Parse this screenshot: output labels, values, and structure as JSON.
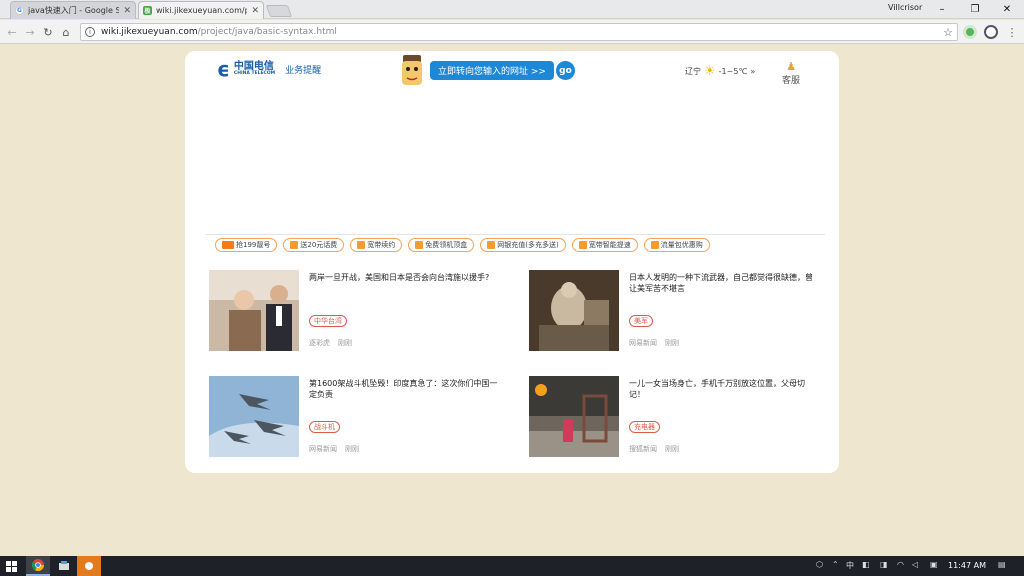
{
  "browser": {
    "tabs": [
      {
        "title": "java快速入门 - Google S",
        "favicon": "G"
      },
      {
        "title": "wiki.jikexueyuan.com/pro",
        "favicon": "极"
      }
    ],
    "user": "Villcrisor",
    "url_host": "wiki.jikexueyuan.com",
    "url_path": "/project/java/basic-syntax.html"
  },
  "header": {
    "logo_cn": "中国电信",
    "logo_en": "CHINA TELECOM",
    "service_label": "业务提醒",
    "redirect_label": "立即转向您输入的网址 >>",
    "go_label": "go",
    "weather_city": "辽宁",
    "weather_temp": "-1~5℃",
    "weather_more": "»",
    "kefu_label": "客服"
  },
  "promo_pills": [
    {
      "icon_text": "199",
      "label": "抢199靓号"
    },
    {
      "icon_text": "",
      "label": "送20元话费"
    },
    {
      "icon_text": "",
      "label": "宽带续约"
    },
    {
      "icon_text": "",
      "label": "免费领机顶盒"
    },
    {
      "icon_text": "",
      "label": "网银充值(多充多送)"
    },
    {
      "icon_text": "",
      "label": "宽带智能提速"
    },
    {
      "icon_text": "",
      "label": "流量包优惠购"
    }
  ],
  "news": [
    {
      "title": "两岸一旦开战，美国和日本是否会向台湾施以援手?",
      "tag": "中华台湾",
      "source": "逐彩虎",
      "time": "刚刚"
    },
    {
      "title": "日本人发明的一种下流武器，自己都觉得很缺德，曾让美军苦不堪言",
      "tag": "美军",
      "source": "网易新闻",
      "time": "刚刚"
    },
    {
      "title": "第1600架战斗机坠毁！印度真急了：这次你们中国一定负责",
      "tag": "战斗机",
      "source": "网易新闻",
      "time": "刚刚"
    },
    {
      "title": "一儿一女当场身亡，手机千万别放这位置，父母切记！",
      "tag": "充电器",
      "source": "搜狐新闻",
      "time": "刚刚"
    }
  ],
  "taskbar": {
    "clock": "11:47 AM"
  },
  "colors": {
    "page_bg": "#efe6cf",
    "telecom_blue": "#1a5ea8",
    "redirect_blue": "#1e88d8",
    "pill_border": "#f2a35c",
    "tag_red": "#e05a4a"
  }
}
